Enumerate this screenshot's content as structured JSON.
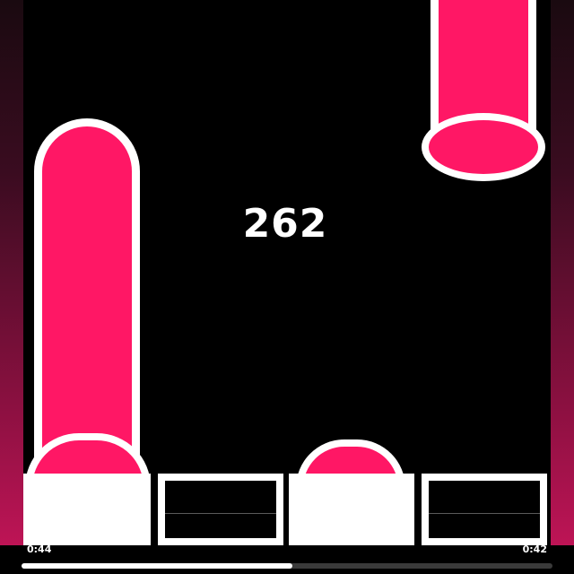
{
  "game": {
    "score": "262",
    "colors": {
      "background": "#000000",
      "tube_fill": "#ff1765",
      "outline": "#ffffff"
    }
  },
  "video": {
    "elapsed": "0:44",
    "remaining": "0:42",
    "progress": 0.51
  }
}
